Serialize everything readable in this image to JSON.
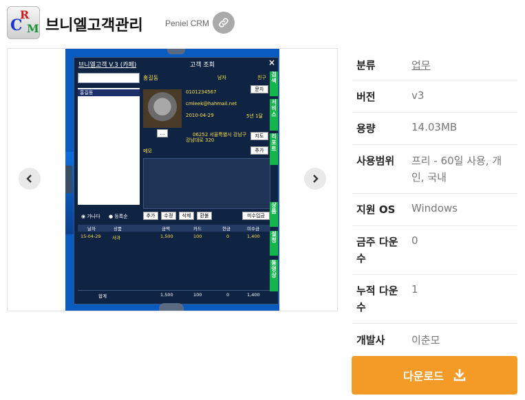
{
  "header": {
    "icon_letters": {
      "c": "C",
      "r": "R",
      "m": "M"
    },
    "title": "브니엘고객관리",
    "subtitle": "Peniel CRM"
  },
  "screenshot": {
    "window_title": "브니엘고객 V.3 (카페)",
    "center_title": "고객 조회",
    "close": "×",
    "list_selected": "홍길동",
    "name": "홍길동",
    "gender": "남자",
    "friend": "친구",
    "phone": "0101234567",
    "email": "cmleek@hahmail.net",
    "date": "2010-04-29",
    "grade": "5년 1달",
    "address_line1": "06252 서울특별시 강남구",
    "address_line2": "강남대로 320",
    "btn_text": "문자",
    "btn_map": "지도",
    "btn_add_memo": "추가",
    "photo_btn": "...",
    "memo_label": "메모",
    "radio_1": "가나다",
    "radio_2": "등록순",
    "actions": [
      "추가",
      "수정",
      "삭제",
      "환불"
    ],
    "unpaid_btn": "미수입금",
    "table_headers": [
      "날자",
      "상품",
      "금액",
      "카드",
      "현금",
      "미수금"
    ],
    "row": [
      "15-04-29",
      "사과",
      "1,500",
      "100",
      "0",
      "1,400"
    ],
    "total": [
      "합계",
      "1,500",
      "100",
      "0",
      "1,400"
    ],
    "side_tabs": [
      "검색",
      "서비스",
      "리포트",
      "상품",
      "설정",
      "동영상"
    ]
  },
  "info": [
    {
      "key": "분류",
      "value": "업무"
    },
    {
      "key": "버전",
      "value": "v3"
    },
    {
      "key": "용량",
      "value": "14.03MB"
    },
    {
      "key": "사용범위",
      "value_line1": "프리 - 60일 사용, 개",
      "value_line2": "인, 국내"
    },
    {
      "key": "지원 OS",
      "value": "Windows"
    },
    {
      "key_line1": "금주 다운",
      "key_line2": "수",
      "value": "0"
    },
    {
      "key_line1": "누적 다운",
      "key_line2": "수",
      "value": "1"
    },
    {
      "key": "개발사",
      "value": "이춘모"
    }
  ],
  "download": {
    "label": "다운로드"
  },
  "colors": {
    "accent": "#f49a26",
    "panel_blue": "#0a5bc0",
    "side_green": "#14b54b"
  }
}
